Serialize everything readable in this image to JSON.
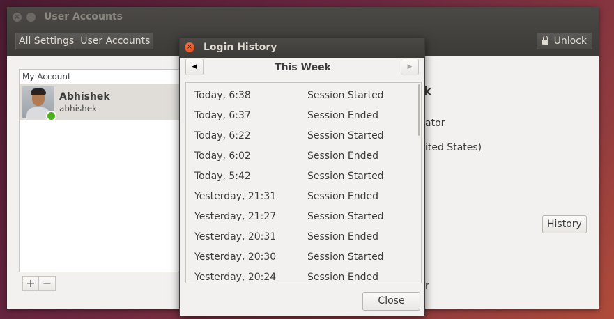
{
  "main_window": {
    "title": "User Accounts",
    "breadcrumb": [
      "All Settings",
      "User Accounts"
    ],
    "unlock_label": "Unlock"
  },
  "account_list": {
    "header": "My Account",
    "user_name": "Abhishek",
    "user_login": "abhishek",
    "add_label": "+",
    "remove_label": "−"
  },
  "details": {
    "fragment_name": "k",
    "fragment_type": "ator",
    "fragment_language": "ited States)",
    "history_label": "History",
    "fragment_bottom": "r"
  },
  "dialog": {
    "title": "Login History",
    "prev_icon": "◀",
    "next_icon": "▶",
    "period_label": "This Week",
    "entries": [
      {
        "time": "Today,  6:38",
        "event": "Session Started"
      },
      {
        "time": "Today,  6:37",
        "event": "Session Ended"
      },
      {
        "time": "Today,  6:22",
        "event": "Session Started"
      },
      {
        "time": "Today,  6:02",
        "event": "Session Ended"
      },
      {
        "time": "Today,  5:42",
        "event": "Session Started"
      },
      {
        "time": "Yesterday, 21:31",
        "event": "Session Ended"
      },
      {
        "time": "Yesterday, 21:27",
        "event": "Session Started"
      },
      {
        "time": "Yesterday, 20:31",
        "event": "Session Ended"
      },
      {
        "time": "Yesterday, 20:30",
        "event": "Session Started"
      },
      {
        "time": "Yesterday, 20:24",
        "event": "Session Ended"
      }
    ],
    "close_label": "Close"
  }
}
